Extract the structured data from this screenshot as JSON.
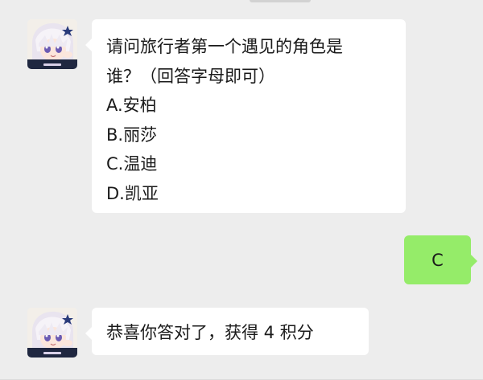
{
  "colors": {
    "background": "#ededed",
    "bubble_received": "#ffffff",
    "bubble_sent": "#95ec69",
    "text": "#1a1a1a"
  },
  "messages": [
    {
      "sender": "other",
      "avatar_icon": "anime-girl-avatar-icon",
      "question_lines": [
        "请问旅行者第一个遇见的角色是",
        "谁？（回答字母即可）"
      ],
      "options": [
        "A.安柏",
        "B.丽莎",
        "C.温迪",
        "D.凯亚"
      ]
    },
    {
      "sender": "self",
      "text": "C"
    },
    {
      "sender": "other",
      "avatar_icon": "anime-girl-avatar-icon",
      "text": "恭喜你答对了，获得 4 积分"
    }
  ]
}
